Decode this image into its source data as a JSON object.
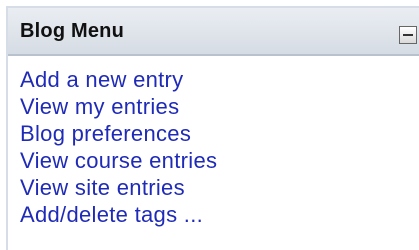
{
  "block": {
    "title": "Blog Menu",
    "collapse_icon": "minus-icon"
  },
  "links": [
    "Add a new entry",
    "View my entries",
    "Blog preferences",
    "View course entries",
    "View site entries",
    "Add/delete tags ..."
  ],
  "colors": {
    "link": "#1f2bb8",
    "header_bg": "#dfe4eb",
    "title": "#111111"
  }
}
